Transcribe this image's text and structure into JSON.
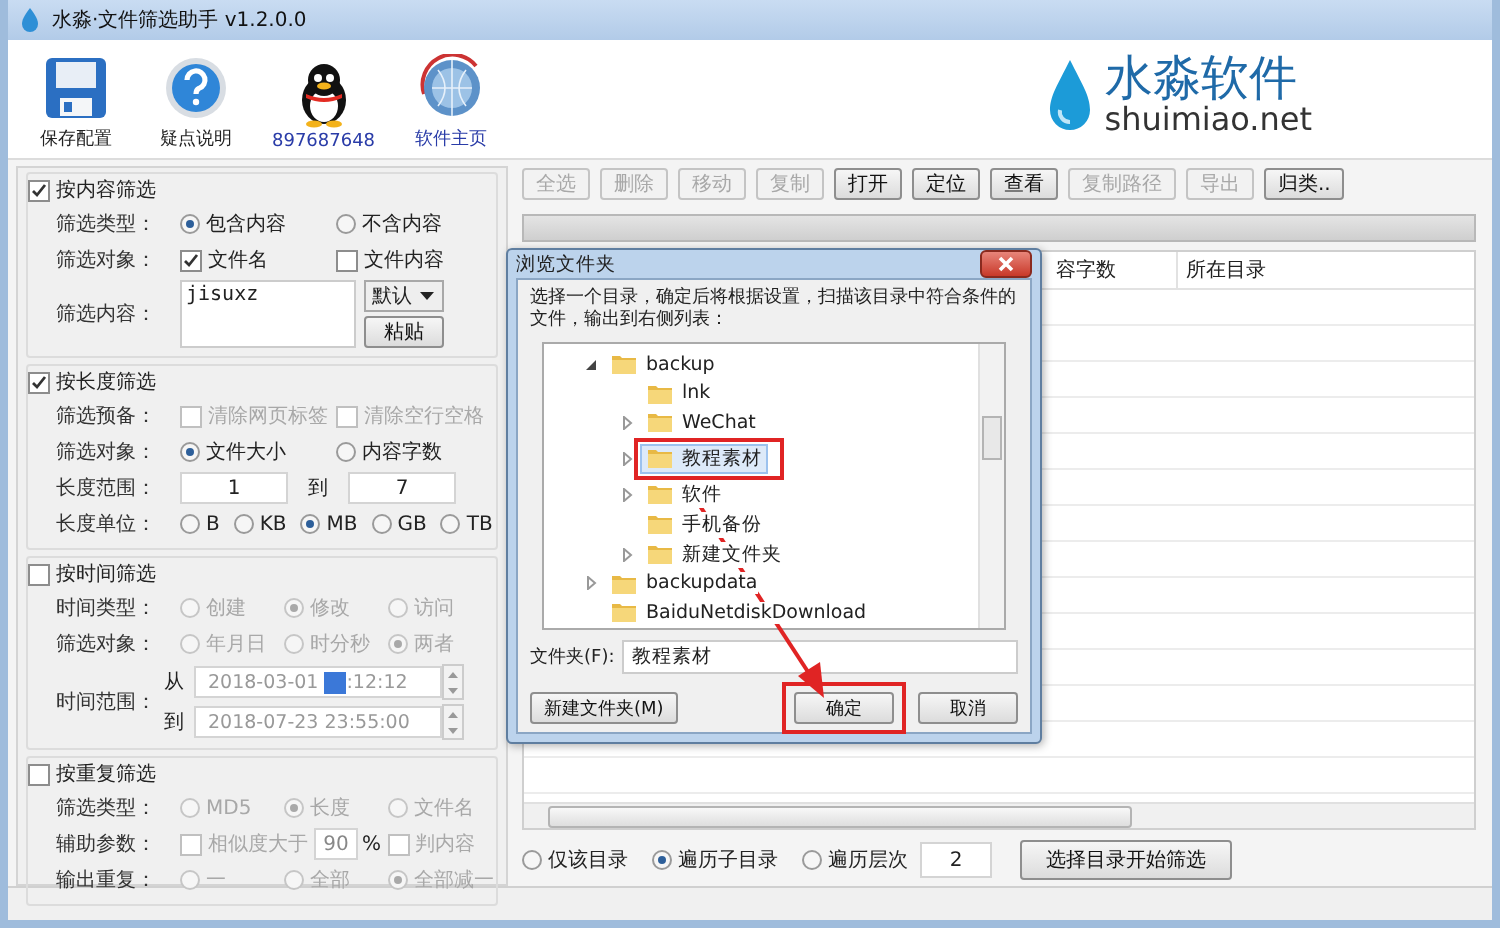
{
  "window": {
    "title": "水淼·文件筛选助手 v1.2.0.0"
  },
  "toolbar": [
    {
      "kind": "save",
      "label": "保存配置",
      "link": false
    },
    {
      "kind": "help",
      "label": "疑点说明",
      "link": false
    },
    {
      "kind": "penguin",
      "label": "897687648",
      "link": true
    },
    {
      "kind": "globe",
      "label": "软件主页",
      "link": true
    }
  ],
  "logo": {
    "name": "水淼软件",
    "url": "shuimiao.net"
  },
  "filters": [
    {
      "title": "按内容筛选",
      "checked": true,
      "rows": [
        {
          "kind": "radio",
          "label": "筛选类型：",
          "disabled": false,
          "options": [
            {
              "label": "包含内容",
              "selected": true
            },
            {
              "label": "不含内容",
              "selected": false
            }
          ]
        },
        {
          "kind": "checks",
          "label": "筛选对象：",
          "disabled": false,
          "options": [
            {
              "label": "文件名",
              "checked": true
            },
            {
              "label": "文件内容",
              "checked": false
            }
          ]
        },
        {
          "kind": "textarea",
          "label": "筛选内容：",
          "value": "jisuxz",
          "dropdown": "默认",
          "button": "粘贴"
        }
      ]
    },
    {
      "title": "按长度筛选",
      "checked": true,
      "rows": [
        {
          "kind": "checks",
          "label": "筛选预备：",
          "disabled": true,
          "options": [
            {
              "label": "清除网页标签",
              "checked": false
            },
            {
              "label": "清除空行空格",
              "checked": false
            }
          ]
        },
        {
          "kind": "radio",
          "label": "筛选对象：",
          "disabled": false,
          "options": [
            {
              "label": "文件大小",
              "selected": true
            },
            {
              "label": "内容字数",
              "selected": false
            }
          ]
        },
        {
          "kind": "range",
          "label": "长度范围：",
          "from": "1",
          "separator": "到",
          "to": "7"
        },
        {
          "kind": "radio",
          "label": "长度单位：",
          "disabled": false,
          "options": [
            {
              "label": "B",
              "selected": false
            },
            {
              "label": "KB",
              "selected": false
            },
            {
              "label": "MB",
              "selected": true
            },
            {
              "label": "GB",
              "selected": false
            },
            {
              "label": "TB",
              "selected": false
            }
          ]
        }
      ]
    },
    {
      "title": "按时间筛选",
      "checked": false,
      "rows": [
        {
          "kind": "radio",
          "label": "时间类型：",
          "disabled": true,
          "options": [
            {
              "label": "创建",
              "selected": false
            },
            {
              "label": "修改",
              "selected": true
            },
            {
              "label": "访问",
              "selected": false
            }
          ]
        },
        {
          "kind": "radio",
          "label": "筛选对象：",
          "disabled": true,
          "options": [
            {
              "label": "年月日",
              "selected": false
            },
            {
              "label": "时分秒",
              "selected": false
            },
            {
              "label": "两者",
              "selected": true
            }
          ]
        },
        {
          "kind": "datetime",
          "label": "时间范围：",
          "fields": [
            {
              "prefix": "从",
              "before": "2018-03-01",
              "highlight": true,
              "after": ":12:12"
            },
            {
              "prefix": "到",
              "before": "2018-07-23 23:55:00",
              "highlight": false
            }
          ]
        }
      ]
    },
    {
      "title": "按重复筛选",
      "checked": false,
      "rows": [
        {
          "kind": "radio",
          "label": "筛选类型：",
          "disabled": true,
          "options": [
            {
              "label": "MD5",
              "selected": false
            },
            {
              "label": "长度",
              "selected": true
            },
            {
              "label": "文件名",
              "selected": false
            }
          ]
        },
        {
          "kind": "similarity",
          "label": "辅助参数：",
          "check_label": "相似度大于",
          "checked": false,
          "value": "90",
          "unit": "%",
          "content_label": "判内容",
          "content_checked": false
        },
        {
          "kind": "radio",
          "label": "输出重复：",
          "disabled": true,
          "options": [
            {
              "label": "一",
              "selected": false
            },
            {
              "label": "全部",
              "selected": false
            },
            {
              "label": "全部减一",
              "selected": true
            }
          ]
        }
      ]
    }
  ],
  "actions": [
    {
      "label": "全选",
      "disabled": true
    },
    {
      "label": "删除",
      "disabled": true
    },
    {
      "label": "移动",
      "disabled": true
    },
    {
      "label": "复制",
      "disabled": true
    },
    {
      "label": "打开",
      "disabled": false
    },
    {
      "label": "定位",
      "disabled": false
    },
    {
      "label": "查看",
      "disabled": false
    },
    {
      "label": "复制路径",
      "disabled": true
    },
    {
      "label": "导出",
      "disabled": true
    },
    {
      "label": "归类..",
      "disabled": false
    }
  ],
  "progress": {
    "level": 0
  },
  "table": {
    "columns": [
      "容字数",
      "所在目录"
    ]
  },
  "scan_options": [
    {
      "label": "仅该目录",
      "selected": false
    },
    {
      "label": "遍历子目录",
      "selected": true
    },
    {
      "label": "遍历层次",
      "selected": false
    }
  ],
  "depth": "2",
  "start_button": "选择目录开始筛选",
  "dialog": {
    "title": "浏览文件夹",
    "description": "选择一个目录，确定后将根据设置，扫描该目录中符合条件的文件，输出到右侧列表：",
    "tree": [
      {
        "label": "backup",
        "expandable": true,
        "expanded": true,
        "selected": false,
        "annotated": false,
        "children": [
          {
            "label": "lnk",
            "expandable": false,
            "selected": false,
            "annotated": false
          },
          {
            "label": "WeChat",
            "expandable": true,
            "expanded": false,
            "selected": false,
            "annotated": false
          },
          {
            "label": "教程素材",
            "expandable": true,
            "expanded": false,
            "selected": true,
            "annotated": true
          },
          {
            "label": "软件",
            "expandable": true,
            "expanded": false,
            "selected": false,
            "annotated": false
          },
          {
            "label": "手机备份",
            "expandable": false,
            "selected": false,
            "annotated": false
          },
          {
            "label": "新建文件夹",
            "expandable": true,
            "expanded": false,
            "selected": false,
            "annotated": false
          }
        ]
      },
      {
        "label": "backupdata",
        "expandable": true,
        "expanded": false,
        "selected": false,
        "annotated": false
      },
      {
        "label": "BaiduNetdiskDownload",
        "expandable": false,
        "selected": false,
        "annotated": false
      }
    ],
    "folder_label": "文件夹(F):",
    "folder_value": "教程素材",
    "buttons": [
      {
        "label": "新建文件夹(M)",
        "annotated": false
      },
      {
        "label": "确定",
        "annotated": true
      },
      {
        "label": "取消",
        "annotated": false
      }
    ]
  }
}
